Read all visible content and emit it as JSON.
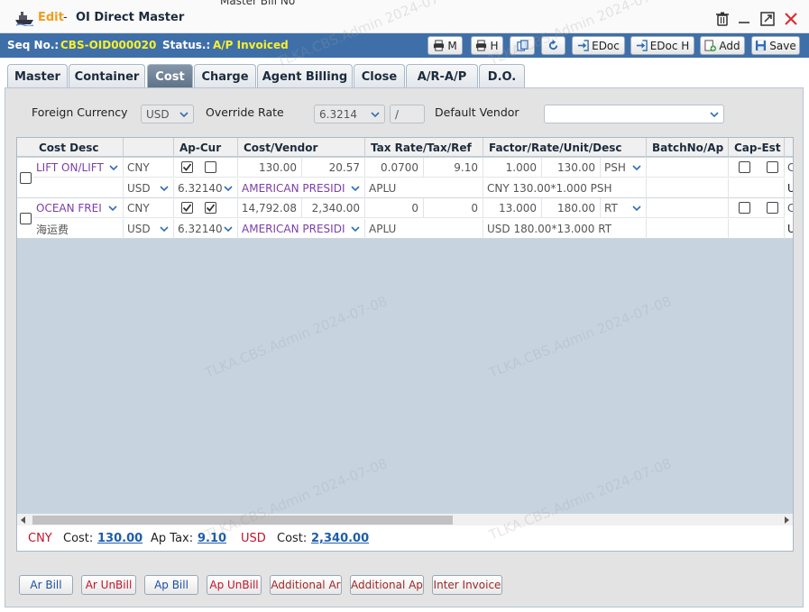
{
  "window": {
    "edit_label": "Edit",
    "separator": "-",
    "title": "OI Direct Master"
  },
  "seqbar": {
    "seq_label": "Seq No.:",
    "seq_value": "CBS-OID000020",
    "status_label": "Status.:",
    "status_value": "A/P Invoiced"
  },
  "toolbar": {
    "print_m": "M",
    "print_h": "H",
    "edoc": "EDoc",
    "edoc_h": "EDoc H",
    "add": "Add",
    "save": "Save"
  },
  "tabs": [
    "Master",
    "Container",
    "Cost",
    "Charge",
    "Agent Billing",
    "Close",
    "A/R-A/P",
    "D.O."
  ],
  "active_tab": "Cost",
  "form": {
    "foreign_currency_label": "Foreign Currency",
    "foreign_currency_value": "USD",
    "override_rate_label": "Override Rate",
    "override_rate_value": "6.3214",
    "override_rate_sep": "/",
    "default_vendor_label": "Default Vendor",
    "default_vendor_value": ""
  },
  "grid": {
    "headers": [
      "Cost Desc",
      "Ap-Cur",
      "Cost/Vendor",
      "Tax Rate/Tax/Ref",
      "Factor/Rate/Unit/Desc",
      "BatchNo/Ap",
      "Cap-Est"
    ],
    "rows": [
      {
        "cost_desc": "LIFT ON/LIFT",
        "currency": "CNY",
        "cost": "130.00",
        "cost2": "20.57",
        "tax_rate": "0.0700",
        "tax": "9.10",
        "factor": "1.000",
        "rate": "130.00",
        "unit": "PSH",
        "ap_cur": "USD",
        "ex_rate": "6.32140",
        "vendor": "AMERICAN PRESIDI",
        "ref": "APLU",
        "desc": "CNY 130.00*1.000 PSH",
        "sub_desc": "",
        "cut_a": "C",
        "cut_b": "U",
        "cb1": true,
        "cb2": false
      },
      {
        "cost_desc": "OCEAN FREI",
        "currency": "CNY",
        "cost": "14,792.08",
        "cost2": "2,340.00",
        "tax_rate": "0",
        "tax": "0",
        "factor": "13.000",
        "rate": "180.00",
        "unit": "RT",
        "ap_cur": "USD",
        "ex_rate": "6.32140",
        "vendor": "AMERICAN PRESIDI",
        "ref": "APLU",
        "desc": "USD 180.00*13.000 RT",
        "sub_desc": "海运费",
        "cut_a": "C",
        "cut_b": "U",
        "cb1": true,
        "cb2": true
      }
    ]
  },
  "summary": {
    "cny_label": "CNY",
    "cost_label": "Cost:",
    "cny_cost": "130.00",
    "ap_tax_label": "Ap Tax:",
    "ap_tax": "9.10",
    "usd_label": "USD",
    "usd_cost_label": "Cost:",
    "usd_cost": "2,340.00"
  },
  "bottom_buttons": [
    "Ar Bill",
    "Ar UnBill",
    "Ap Bill",
    "Ap UnBill",
    "Additional Ar",
    "Additional Ap",
    "Inter Invoice"
  ],
  "watermark": "TLKA.CBS.Admin 2024-07-08",
  "background_tab_fragment": "Master Bill No",
  "colors": {
    "accent_blue": "#3f6fa8",
    "status_yellow": "#f7f02c",
    "edit_orange": "#f29c1f",
    "link_blue": "#1e5ea8",
    "vendor_purple": "#7b3fa8",
    "unbill_red": "#c0142a",
    "bill_blue": "#1c4fa0",
    "close_red": "#e0262d"
  }
}
